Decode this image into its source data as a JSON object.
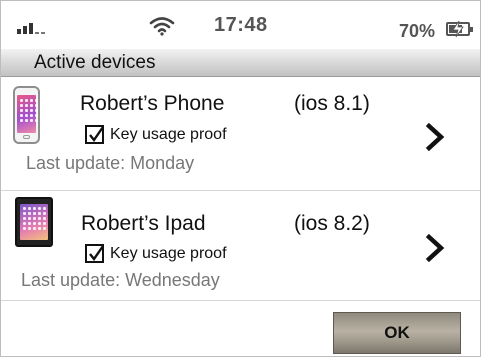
{
  "status_bar": {
    "time": "17:48",
    "battery_percent": "70%",
    "battery_level": 0.7,
    "signal_icon": "signal-bars-icon",
    "wifi_icon": "wifi-icon",
    "battery_icon": "battery-charging-icon"
  },
  "section": {
    "title": "Active devices"
  },
  "devices": [
    {
      "name": "Robert’s Phone",
      "os": "(ios 8.1)",
      "key_usage_label": "Key usage proof",
      "key_usage_checked": true,
      "last_update": "Last update: Monday",
      "thumbnail_icon": "iphone-icon",
      "chevron_icon": "chevron-right-icon"
    },
    {
      "name": "Robert’s Ipad",
      "os": "(ios 8.2)",
      "key_usage_label": "Key usage proof",
      "key_usage_checked": true,
      "last_update": "Last update: Wednesday",
      "thumbnail_icon": "ipad-icon",
      "chevron_icon": "chevron-right-icon"
    }
  ],
  "actions": {
    "ok_label": "OK"
  },
  "colors": {
    "header_gradient_top": "#f2f2f2",
    "header_gradient_bottom": "#c2c2c2",
    "button_bg": "#a09a8d",
    "muted_text": "#777777"
  }
}
